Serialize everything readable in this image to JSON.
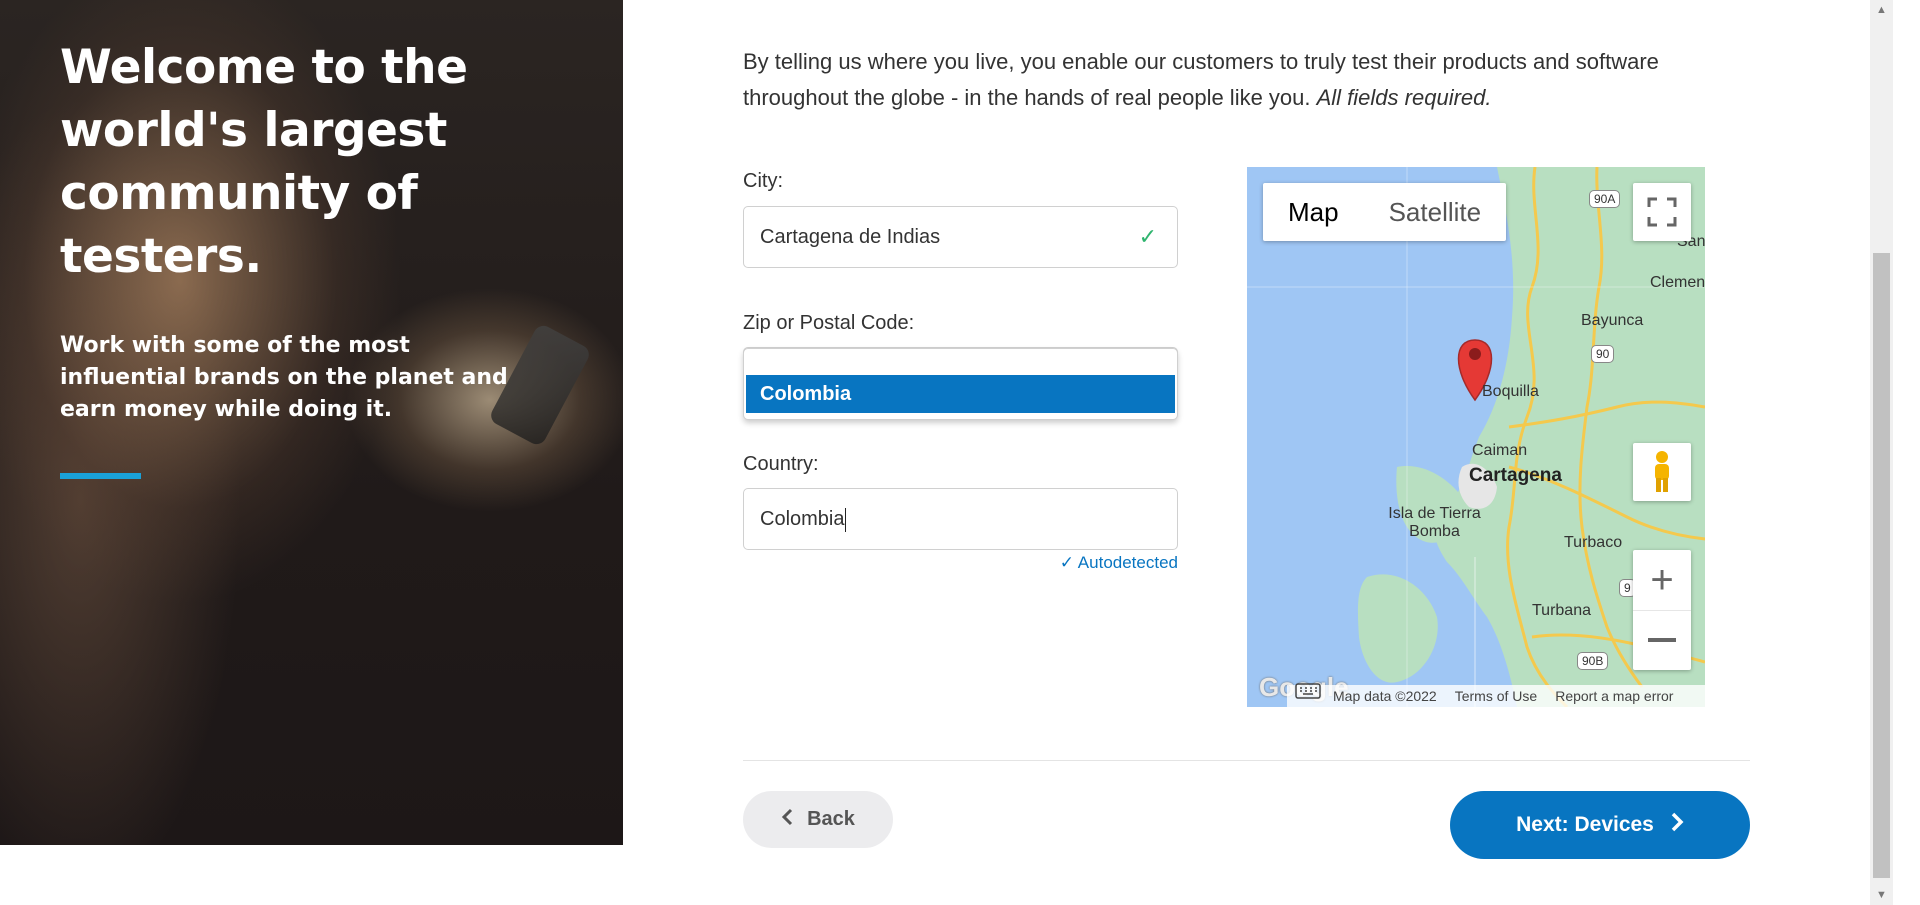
{
  "hero": {
    "title": "Welcome to the world's largest community of testers.",
    "subtitle": "Work with some of the most influential brands on the planet and earn money while doing it."
  },
  "intro": {
    "text": "By telling us where you live, you enable our customers to truly test their products and software throughout the globe - in the hands of real people like you. ",
    "required": "All fields required."
  },
  "form": {
    "city_label": "City:",
    "city_value": "Cartagena de Indias",
    "zip_label": "Zip or Postal Code:",
    "zip_dropdown_option": "Colombia",
    "country_label": "Country:",
    "country_value": "Colombia",
    "autodetected": "Autodetected"
  },
  "map": {
    "map_tab": "Map",
    "satellite_tab": "Satellite",
    "active_tab": "Map",
    "places": [
      "Cartagena",
      "Boquilla",
      "Caiman",
      "Isla de Tierra Bomba",
      "Bayunca",
      "Turbaco",
      "Turbana",
      "Clemen",
      "San"
    ],
    "shields": [
      "90A",
      "90",
      "90B",
      "9"
    ],
    "footer": {
      "data": "Map data ©2022",
      "terms": "Terms of Use",
      "report": "Report a map error"
    },
    "logo": "Google"
  },
  "nav": {
    "back": "Back",
    "next": "Next: Devices"
  },
  "colors": {
    "primary": "#0875c1",
    "accent": "#1aa1d8",
    "success": "#2fb46e"
  }
}
